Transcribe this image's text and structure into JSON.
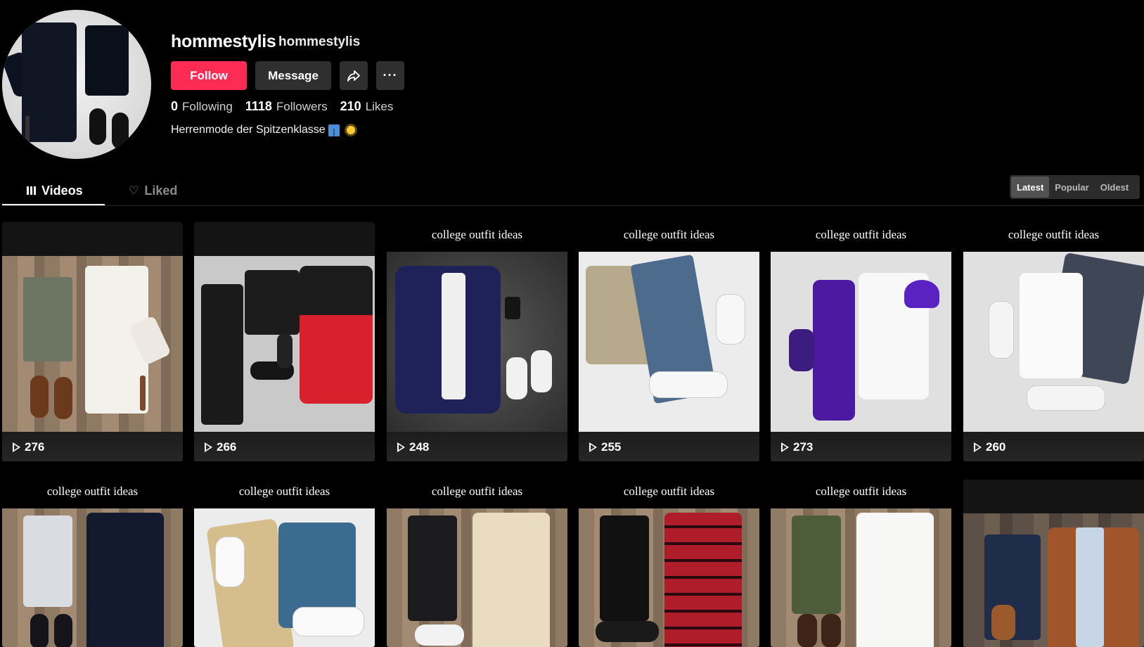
{
  "profile": {
    "username": "hommestylis",
    "nickname": "hommestylis",
    "follow_label": "Follow",
    "message_label": "Message",
    "more_label": "···",
    "stats": [
      {
        "value": "0",
        "label": "Following"
      },
      {
        "value": "1118",
        "label": "Followers"
      },
      {
        "value": "210",
        "label": "Likes"
      }
    ],
    "bio": "Herrenmode der Spitzenklasse"
  },
  "tabs": [
    {
      "label": "Videos",
      "icon": "grid-icon",
      "active": true
    },
    {
      "label": "Liked",
      "icon": "heart-lock-icon",
      "active": false
    }
  ],
  "sort": {
    "options": [
      "Latest",
      "Popular",
      "Oldest"
    ],
    "selected": "Latest"
  },
  "videos": [
    {
      "title": "",
      "views": "276"
    },
    {
      "title": "",
      "views": "266"
    },
    {
      "title": "college outfit ideas",
      "views": "248"
    },
    {
      "title": "college outfit ideas",
      "views": "255"
    },
    {
      "title": "college outfit ideas",
      "views": "273"
    },
    {
      "title": "college outfit ideas",
      "views": "260"
    },
    {
      "title": "college outfit ideas",
      "views": ""
    },
    {
      "title": "college outfit ideas",
      "views": ""
    },
    {
      "title": "college outfit ideas",
      "views": ""
    },
    {
      "title": "college outfit ideas",
      "views": ""
    },
    {
      "title": "college outfit ideas",
      "views": ""
    },
    {
      "title": "",
      "views": ""
    }
  ],
  "colors": {
    "accent": "#fe2c55",
    "background": "#000000",
    "button_secondary": "#2f2f2f"
  }
}
